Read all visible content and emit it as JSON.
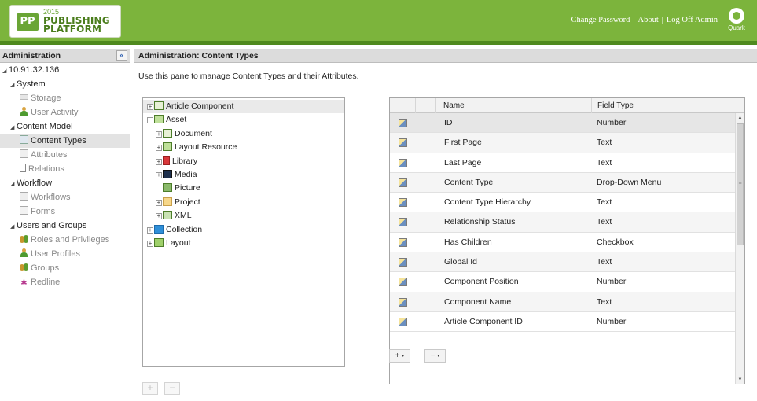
{
  "header": {
    "logo_badge": "PP",
    "logo_year": "2015",
    "logo_line1": "PUBLISHING",
    "logo_line2": "PLATFORM",
    "links": [
      "Change Password",
      "About",
      "Log Off Admin"
    ],
    "separator": "|",
    "brand": "Quark",
    "color": "#7cb43c"
  },
  "left_panel": {
    "title": "Administration",
    "collapse_symbol": "«",
    "items": [
      {
        "label": "10.91.32.136",
        "indent": 0,
        "expandable": true
      },
      {
        "label": "System",
        "indent": 1,
        "expandable": true
      },
      {
        "label": "Storage",
        "indent": 2,
        "icon": "storage-icon",
        "muted": true
      },
      {
        "label": "User Activity",
        "indent": 2,
        "icon": "user-activity-icon",
        "muted": true
      },
      {
        "label": "Content Model",
        "indent": 1,
        "expandable": true
      },
      {
        "label": "Content Types",
        "indent": 2,
        "icon": "content-types-icon",
        "selected": true
      },
      {
        "label": "Attributes",
        "indent": 2,
        "icon": "attributes-icon",
        "muted": true
      },
      {
        "label": "Relations",
        "indent": 2,
        "icon": "relations-icon",
        "muted": true
      },
      {
        "label": "Workflow",
        "indent": 1,
        "expandable": true
      },
      {
        "label": "Workflows",
        "indent": 2,
        "icon": "workflows-icon",
        "muted": true
      },
      {
        "label": "Forms",
        "indent": 2,
        "icon": "forms-icon",
        "muted": true
      },
      {
        "label": "Users and Groups",
        "indent": 1,
        "expandable": true
      },
      {
        "label": "Roles and Privileges",
        "indent": 2,
        "icon": "roles-icon",
        "muted": true
      },
      {
        "label": "User Profiles",
        "indent": 2,
        "icon": "user-profiles-icon",
        "muted": true
      },
      {
        "label": "Groups",
        "indent": 2,
        "icon": "groups-icon",
        "muted": true
      },
      {
        "label": "Redline",
        "indent": 2,
        "icon": "redline-icon",
        "muted": true
      }
    ]
  },
  "main": {
    "title": "Administration: Content Types",
    "description": "Use this pane to manage Content Types and their Attributes.",
    "tree": [
      {
        "label": "Article Component",
        "level": 0,
        "icon": "article-component-icon",
        "toggle": "plus",
        "selected": true
      },
      {
        "label": "Asset",
        "level": 0,
        "icon": "asset-icon",
        "toggle": "minus"
      },
      {
        "label": "Document",
        "level": 1,
        "icon": "document-icon",
        "toggle": "plus"
      },
      {
        "label": "Layout Resource",
        "level": 1,
        "icon": "layout-resource-icon",
        "toggle": "plus"
      },
      {
        "label": "Library",
        "level": 1,
        "icon": "library-icon",
        "toggle": "plus"
      },
      {
        "label": "Media",
        "level": 1,
        "icon": "media-icon",
        "toggle": "plus"
      },
      {
        "label": "Picture",
        "level": 1,
        "icon": "picture-icon",
        "toggle": "none"
      },
      {
        "label": "Project",
        "level": 1,
        "icon": "project-icon",
        "toggle": "plus"
      },
      {
        "label": "XML",
        "level": 1,
        "icon": "xml-icon",
        "toggle": "plus"
      },
      {
        "label": "Collection",
        "level": 0,
        "icon": "collection-icon",
        "toggle": "plus"
      },
      {
        "label": "Layout",
        "level": 0,
        "icon": "layout-icon",
        "toggle": "plus"
      }
    ],
    "grid": {
      "columns": [
        "Name",
        "Field Type"
      ],
      "rows": [
        {
          "name": "ID",
          "type": "Number"
        },
        {
          "name": "First Page",
          "type": "Text"
        },
        {
          "name": "Last Page",
          "type": "Text"
        },
        {
          "name": "Content Type",
          "type": "Drop-Down Menu"
        },
        {
          "name": "Content Type Hierarchy",
          "type": "Text"
        },
        {
          "name": "Relationship Status",
          "type": "Text"
        },
        {
          "name": "Has Children",
          "type": "Checkbox"
        },
        {
          "name": "Global Id",
          "type": "Text"
        },
        {
          "name": "Component Position",
          "type": "Number"
        },
        {
          "name": "Component Name",
          "type": "Text"
        },
        {
          "name": "Article Component ID",
          "type": "Number"
        }
      ]
    },
    "tree_buttons": {
      "add": "+",
      "remove": "−"
    },
    "grid_buttons": {
      "add": "+",
      "remove": "−",
      "arrow": "▾"
    }
  }
}
